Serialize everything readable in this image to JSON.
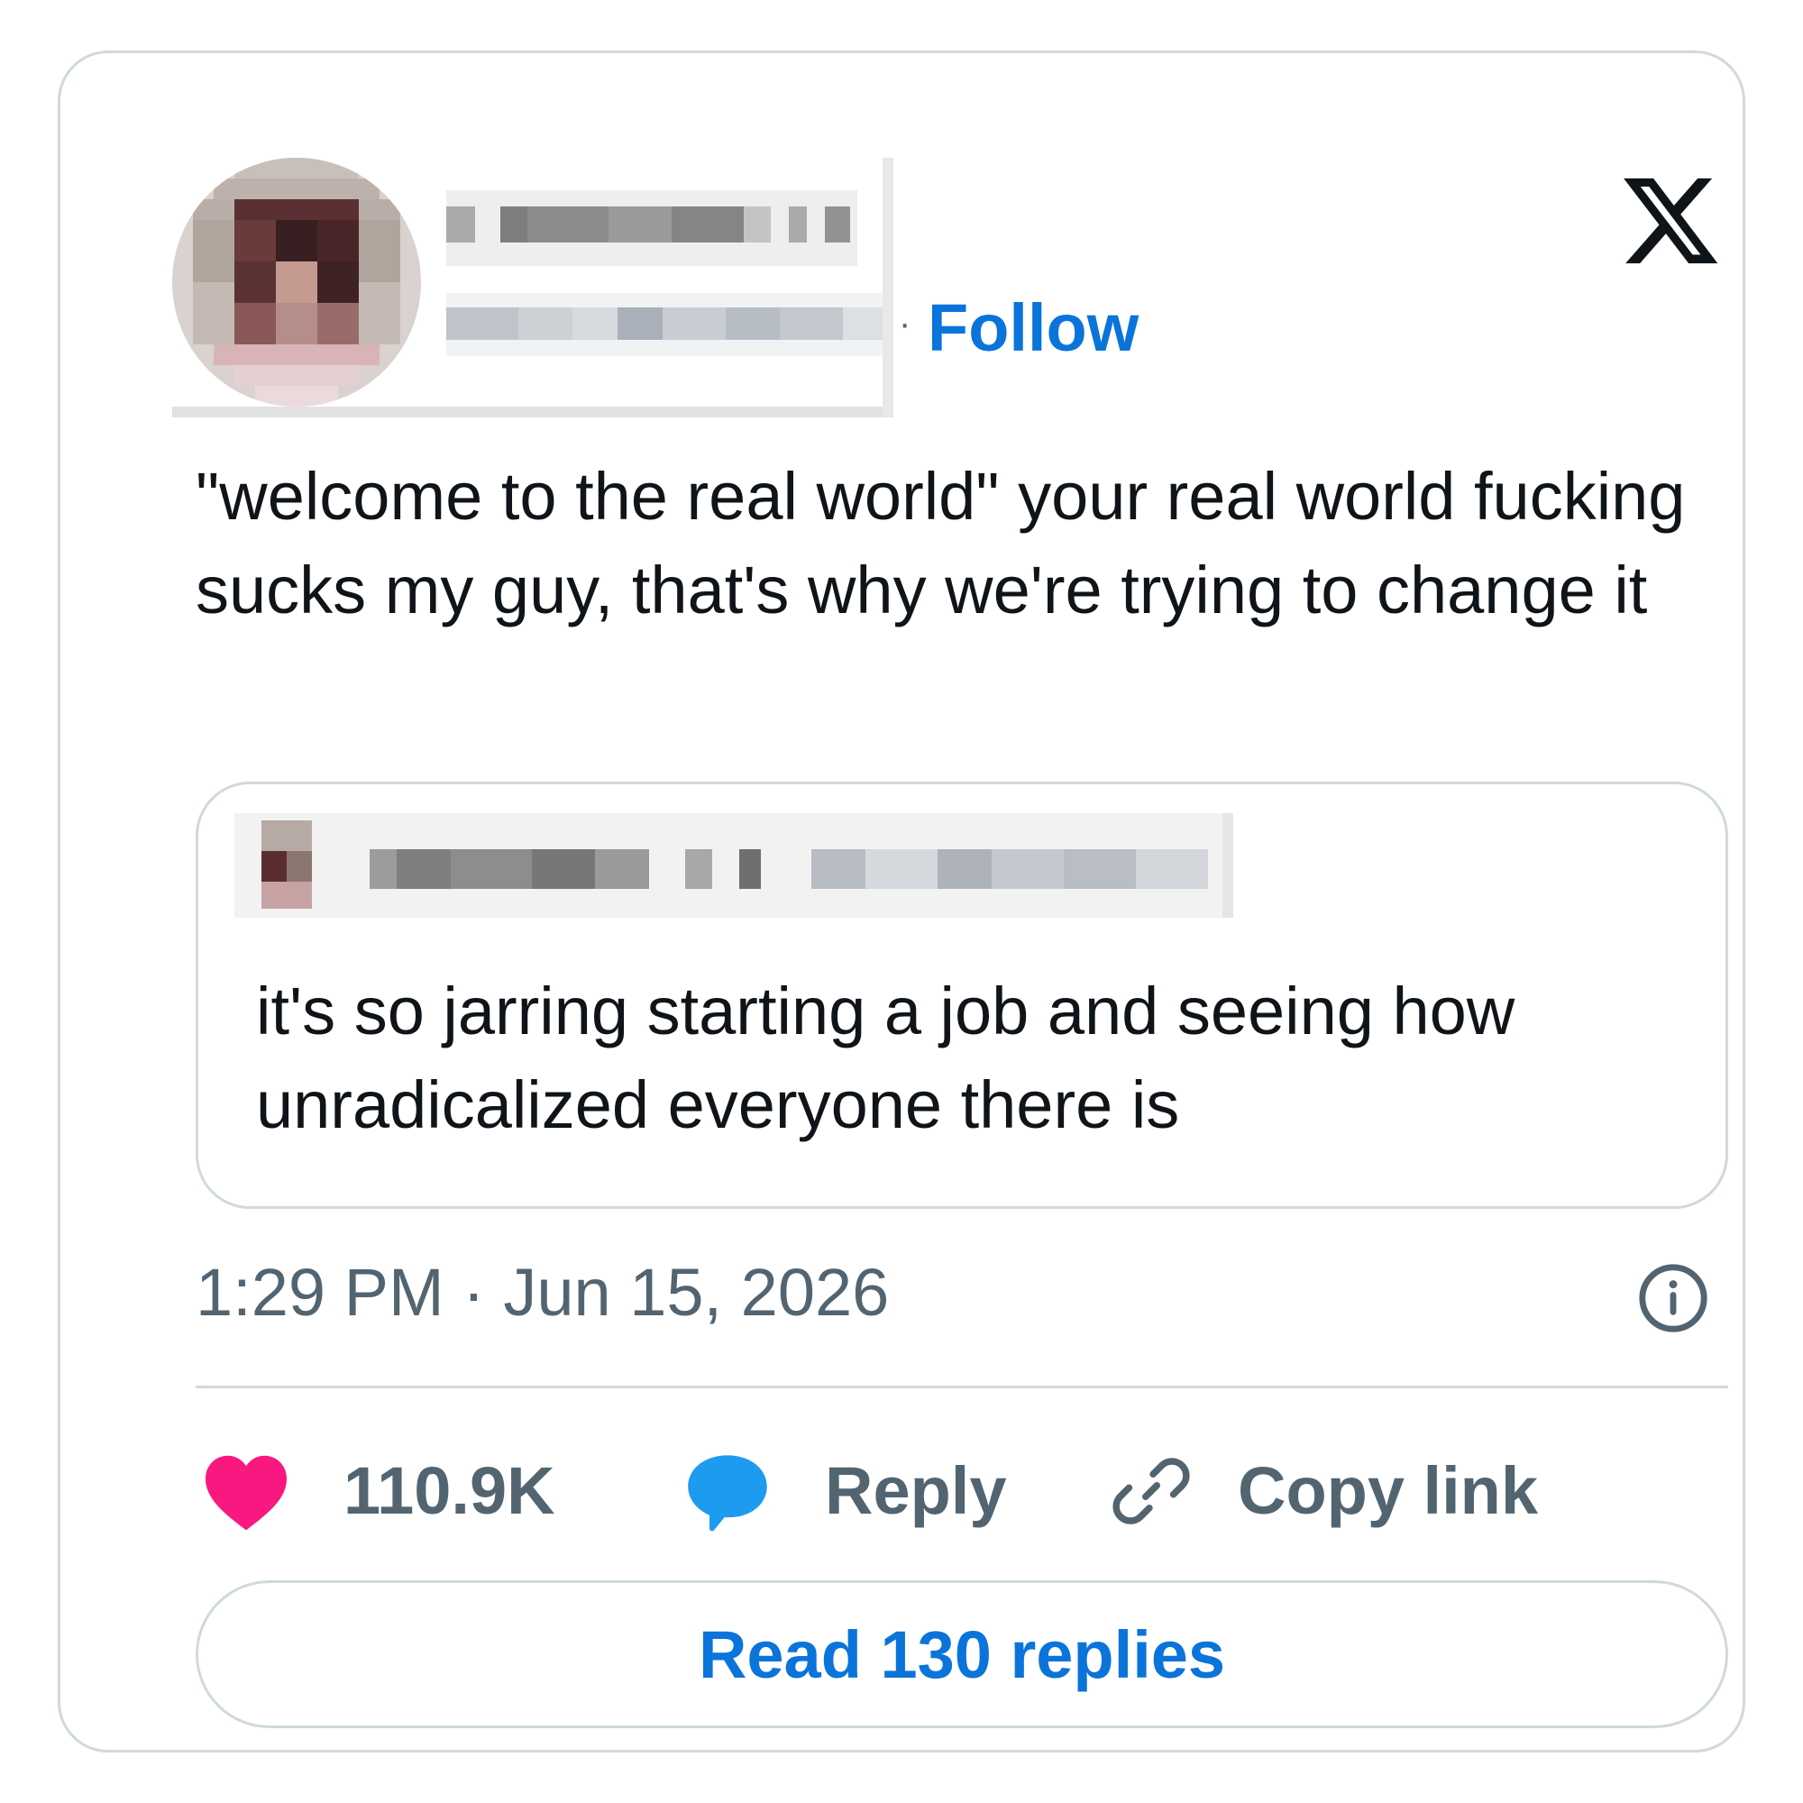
{
  "author": {
    "follow_label": "Follow",
    "separator": "·",
    "avatar_icon": "avatar-pixelated"
  },
  "platform_logo": "x-logo",
  "tweet": {
    "text": "\"welcome to the real world\" your real world fucking sucks my guy, that's why we're trying to change it"
  },
  "quoted_tweet": {
    "text": "it's so jarring starting a job and seeing how unradicalized everyone there is"
  },
  "meta": {
    "time": "1:29 PM",
    "separator": " · ",
    "date": "Jun 15, 2026",
    "info_icon": "info-icon"
  },
  "actions": {
    "like_count": "110.9K",
    "reply_label": "Reply",
    "copy_link_label": "Copy link"
  },
  "read_replies_label": "Read 130 replies",
  "colors": {
    "accent_blue": "#0a74da",
    "like_pink": "#f91880",
    "reply_blue": "#1d9bf0",
    "muted_text": "#536471",
    "border": "#cfd9de",
    "text": "#0f1419"
  }
}
